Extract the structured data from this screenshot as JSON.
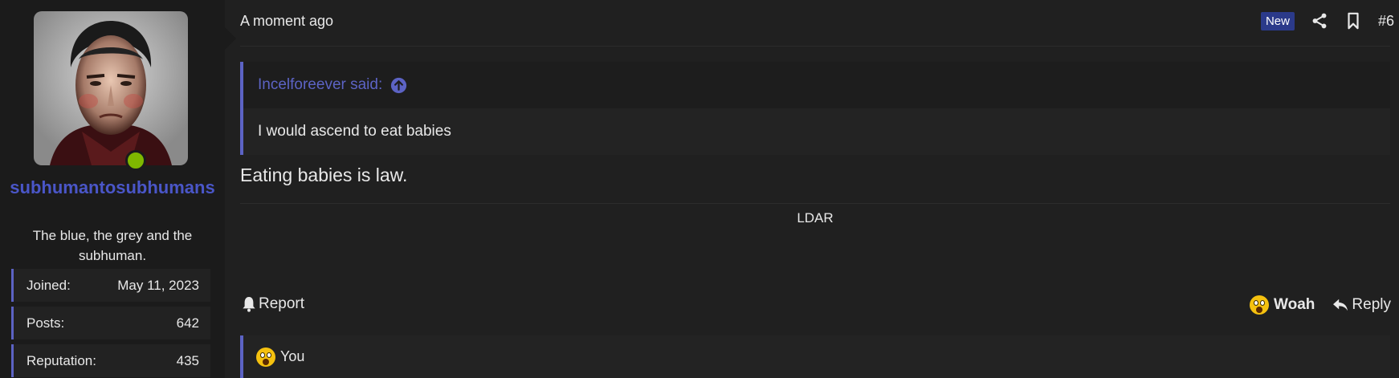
{
  "user": {
    "username": "subhumantosubhumans",
    "title": "The blue, the grey and the subhuman.",
    "online": true,
    "stats": [
      {
        "label": "Joined:",
        "value": "May 11, 2023"
      },
      {
        "label": "Posts:",
        "value": "642"
      },
      {
        "label": "Reputation:",
        "value": "435"
      }
    ]
  },
  "post": {
    "time": "A moment ago",
    "badge": "New",
    "number": "#6",
    "quote": {
      "author_line": "Incelforeever said:",
      "text": "I would ascend to eat babies"
    },
    "body": "Eating babies is law.",
    "signature": "LDAR"
  },
  "footer": {
    "report_label": "Report",
    "reaction_label": "Woah",
    "reply_label": "Reply"
  },
  "reactions": {
    "text": "You"
  },
  "colors": {
    "accent": "#5c63c4",
    "username": "#4a56c8",
    "online": "#7fb800",
    "badge_bg": "#2b3a8a",
    "background": "#202020"
  },
  "icons": [
    "share-icon",
    "bookmark-icon",
    "arrow-up-circle-icon",
    "bell-icon",
    "astonished-emoji-icon",
    "reply-icon"
  ]
}
